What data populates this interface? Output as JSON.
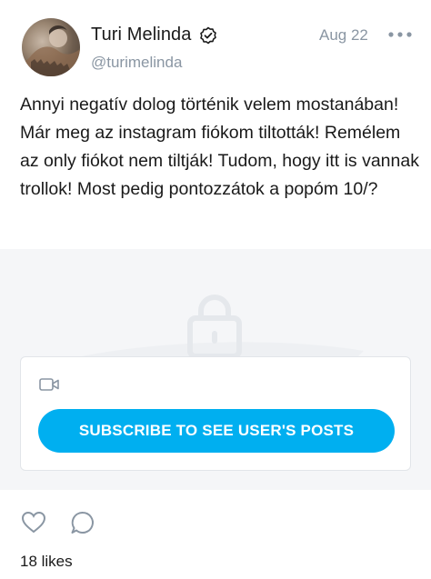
{
  "post": {
    "author_name": "Turi Melinda",
    "author_handle": "@turimelinda",
    "date": "Aug 22",
    "text": "Annyi negatív dolog történik velem mostanában! Már meg az instagram fiókom tiltották! Remélem az only fiókot nem tiltják! Tudom, hogy itt is vannak trollok! Most pedig pontozzátok a popóm 10/?",
    "likes_text": "18 likes"
  },
  "locked_content": {
    "subscribe_label": "SUBSCRIBE TO SEE USER'S POSTS"
  },
  "icons": {
    "verified": "verified-badge-icon",
    "more": "more-horizontal-icon",
    "lock": "lock-icon",
    "video": "video-camera-icon",
    "like": "heart-icon",
    "comment": "comment-bubble-icon"
  },
  "colors": {
    "accent": "#00aff0",
    "muted_text": "#8a96a3",
    "locked_bg": "#f5f6f8",
    "border": "#e2e5e9"
  }
}
